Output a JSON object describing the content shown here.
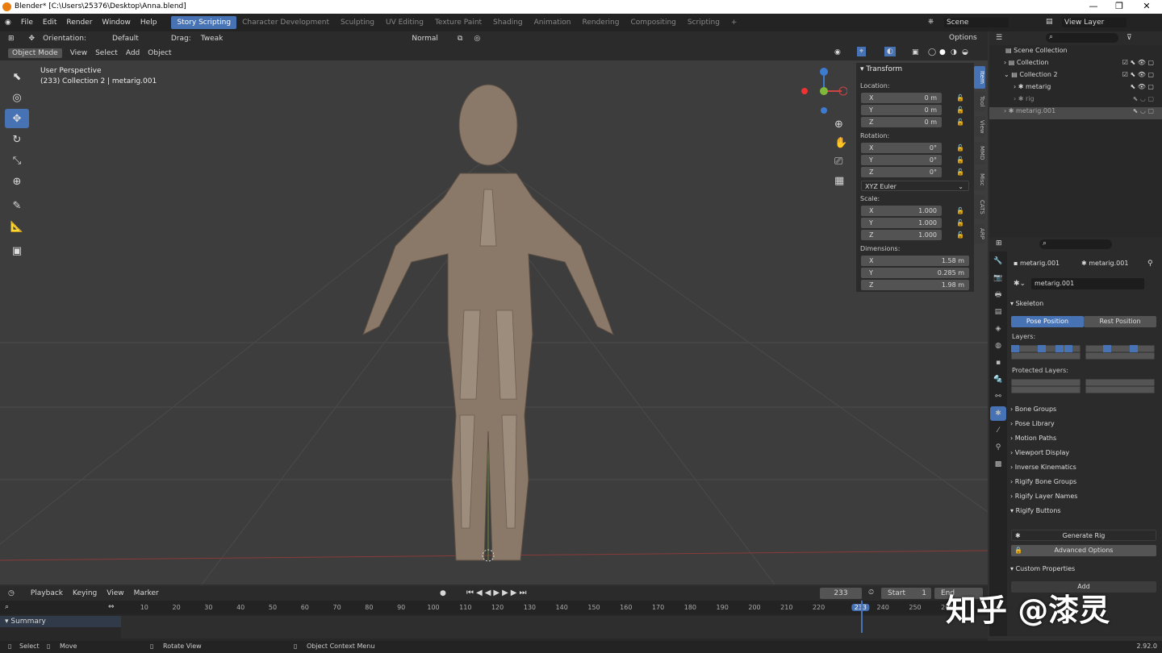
{
  "window": {
    "title": "Blender* [C:\\Users\\25376\\Desktop\\Anna.blend]"
  },
  "menu": {
    "items": [
      "File",
      "Edit",
      "Render",
      "Window",
      "Help"
    ]
  },
  "workspaces": [
    "Story Scripting",
    "Character Development",
    "Sculpting",
    "UV Editing",
    "Texture Paint",
    "Shading",
    "Animation",
    "Rendering",
    "Compositing",
    "Scripting"
  ],
  "active_workspace": "Story Scripting",
  "scene": {
    "label": "Scene",
    "view_layer": "View Layer"
  },
  "tool_header": {
    "orientation_label": "Orientation:",
    "orientation_value": "Default",
    "drag_label": "Drag:",
    "drag_value": "Tweak",
    "pivot_value": "Normal",
    "options": "Options"
  },
  "viewport_header": {
    "mode": "Object Mode",
    "view": "View",
    "select": "Select",
    "add": "Add",
    "object": "Object"
  },
  "viewport": {
    "perspective": "User Perspective",
    "context": "(233) Collection 2 | metarig.001"
  },
  "transform": {
    "title": "Transform",
    "location_label": "Location:",
    "location": [
      {
        "k": "X",
        "v": "0 m"
      },
      {
        "k": "Y",
        "v": "0 m"
      },
      {
        "k": "Z",
        "v": "0 m"
      }
    ],
    "rotation_label": "Rotation:",
    "rotation": [
      {
        "k": "X",
        "v": "0°"
      },
      {
        "k": "Y",
        "v": "0°"
      },
      {
        "k": "Z",
        "v": "0°"
      }
    ],
    "rotation_mode": "XYZ Euler",
    "scale_label": "Scale:",
    "scale": [
      {
        "k": "X",
        "v": "1.000"
      },
      {
        "k": "Y",
        "v": "1.000"
      },
      {
        "k": "Z",
        "v": "1.000"
      }
    ],
    "dimensions_label": "Dimensions:",
    "dimensions": [
      {
        "k": "X",
        "v": "1.58 m"
      },
      {
        "k": "Y",
        "v": "0.285 m"
      },
      {
        "k": "Z",
        "v": "1.98 m"
      }
    ]
  },
  "side_tabs": [
    "Item",
    "Tool",
    "View",
    "MMD",
    "Misc",
    "CATS",
    "ARP"
  ],
  "outliner": {
    "rows": [
      "Scene Collection",
      "Collection",
      "Collection 2",
      "metarig",
      "rig",
      "metarig.001"
    ]
  },
  "properties": {
    "object_name": "metarig.001",
    "data_name": "metarig.001",
    "armature_name": "metarig.001",
    "skeleton": "Skeleton",
    "pose_position": "Pose Position",
    "rest_position": "Rest Position",
    "layers": "Layers:",
    "protected_layers": "Protected Layers:",
    "panels": [
      "Bone Groups",
      "Pose Library",
      "Motion Paths",
      "Viewport Display",
      "Inverse Kinematics",
      "Rigify Bone Groups",
      "Rigify Layer Names",
      "Rigify Buttons"
    ],
    "generate_rig": "Generate Rig",
    "advanced_options": "Advanced Options",
    "custom_properties": "Custom Properties",
    "add": "Add"
  },
  "timeline": {
    "playback": "Playback",
    "keying": "Keying",
    "view": "View",
    "marker": "Marker",
    "current_frame": "233",
    "start_label": "Start",
    "start_value": "1",
    "end_label": "End",
    "summary": "Summary",
    "ticks": [
      "10",
      "20",
      "30",
      "40",
      "50",
      "60",
      "70",
      "80",
      "90",
      "100",
      "110",
      "120",
      "130",
      "140",
      "150",
      "160",
      "170",
      "180",
      "190",
      "200",
      "210",
      "220",
      "233",
      "240",
      "250",
      "260"
    ]
  },
  "status": {
    "select": "Select",
    "move": "Move",
    "rotate_view": "Rotate View",
    "context_menu": "Object Context Menu",
    "version": "2.92.0"
  },
  "watermark": "知乎 @漆灵"
}
